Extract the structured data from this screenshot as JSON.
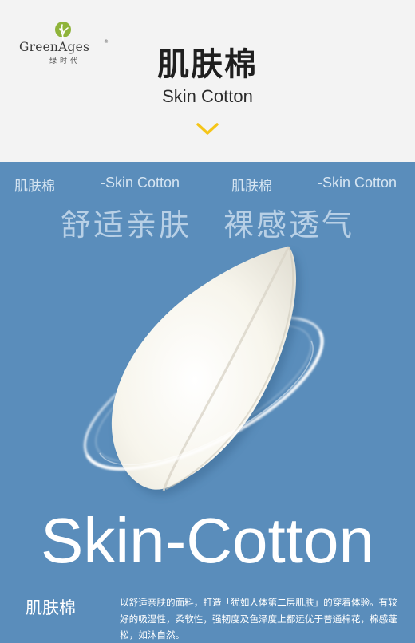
{
  "brand": {
    "name": "GreenAges",
    "registered_mark": "®",
    "subtitle": "绿时代",
    "icon": "tree-logo-icon"
  },
  "header": {
    "title_cn": "肌肤棉",
    "title_en": "Skin Cotton",
    "chevron_icon": "chevron-down-icon",
    "chevron_color": "#f5c518"
  },
  "panel": {
    "background": "#5a8dbb",
    "tags": [
      "肌肤棉",
      "-Skin Cotton",
      "肌肤棉",
      "-Skin Cotton"
    ],
    "slogan_left": "舒适亲肤",
    "slogan_right": "裸感透气",
    "product_image": "skin-cotton-pad-image",
    "headline_en": "Skin-Cotton",
    "desc_title": "肌肤棉",
    "description": "以舒适亲肤的面料，打造「犹如人体第二层肌肤」的穿着体验。有较好的吸湿性，柔软性，强韧度及色泽度上都远优于普通棉花，棉感蓬松，如沐自然。"
  }
}
